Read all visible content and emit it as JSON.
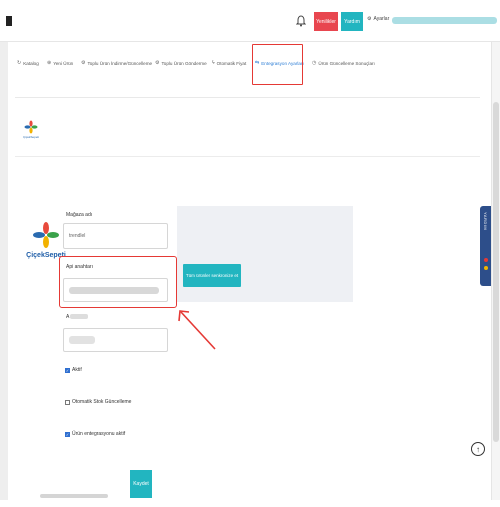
{
  "topbar": {
    "new_label": "Yenilikler",
    "help_label": "Yardım",
    "settings_label": "Ayarlar",
    "bell_icon": "bell-icon",
    "gear_icon": "gear-icon"
  },
  "nav": {
    "tabs": [
      {
        "icon": "refresh-icon",
        "label": "Katalog"
      },
      {
        "icon": "plus-icon",
        "label": "Yeni Ürün"
      },
      {
        "icon": "gear-icon",
        "label": "Toplu Ürün İndirme/Güncelleme"
      },
      {
        "icon": "gear-icon",
        "label": "Toplu Ürün Gönderme"
      },
      {
        "icon": "bolt-icon",
        "label": "Otomatik Fiyat"
      },
      {
        "icon": "sync-icon",
        "label": "Entegrasyon Ayarları"
      },
      {
        "icon": "clock-icon",
        "label": "Ürün Güncelleme Sonuçları"
      }
    ],
    "active_tab": "Entegrasyon Ayarları"
  },
  "marketplace": {
    "brand_caption_small": "ÇiçekSepeti",
    "brand_caption_big": "ÇiçekSepeti"
  },
  "form": {
    "store_name_label": "Mağaza adı",
    "store_name_value": "trendlel",
    "api_key_label": "Api anahtarı",
    "third_label": "A",
    "save_mapping_button": "Tüm ürünler senkronize et",
    "checkboxes": [
      {
        "label": "Aktif",
        "checked": true
      },
      {
        "label": "Otomatik Stok Güncelleme",
        "checked": false
      },
      {
        "label": "Ürün entegrasyonu aktif",
        "checked": true
      }
    ],
    "save_button": "Kaydet"
  },
  "help_tab": {
    "label": "YARDIM"
  },
  "colors": {
    "accent_teal": "#22b5c0",
    "accent_red": "#e8464f",
    "highlight_red": "#e53935",
    "link_blue": "#2f7fd6"
  }
}
